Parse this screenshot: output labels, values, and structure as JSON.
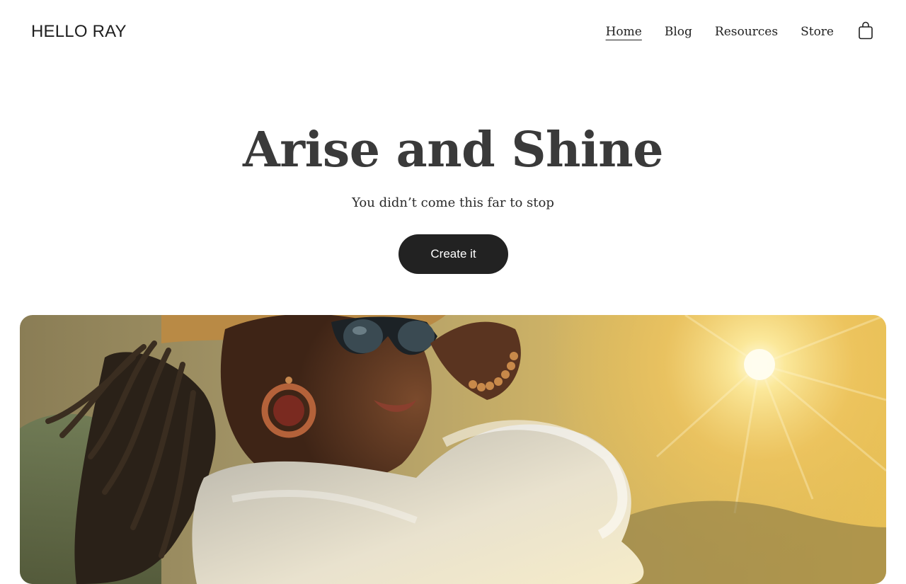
{
  "header": {
    "logo": "HELLO RAY",
    "nav": [
      {
        "label": "Home",
        "active": true
      },
      {
        "label": "Blog",
        "active": false
      },
      {
        "label": "Resources",
        "active": false
      },
      {
        "label": "Store",
        "active": false
      }
    ],
    "cart_icon": "shopping-bag-icon"
  },
  "hero": {
    "title": "Arise and Shine",
    "subtitle": "You didn’t come this far to stop",
    "cta_label": "Create it"
  },
  "colors": {
    "text": "#1f1f1f",
    "title": "#3a3a3a",
    "button": "#222222",
    "button_text": "#ffffff"
  }
}
